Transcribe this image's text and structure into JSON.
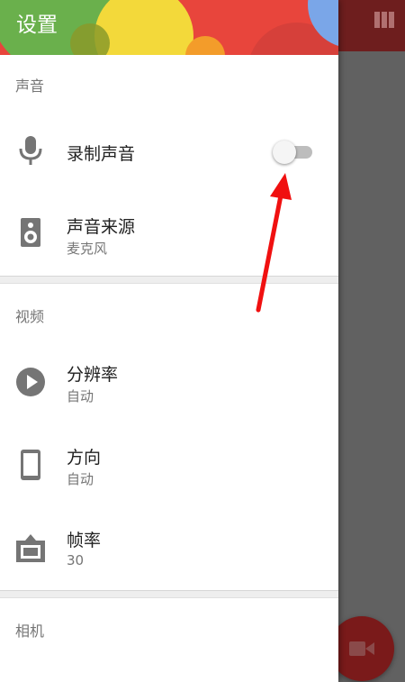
{
  "drawer": {
    "title": "设置"
  },
  "sections": {
    "audio": {
      "header": "声音",
      "record_audio": {
        "title": "录制声音",
        "icon": "microphone-icon",
        "enabled": false
      },
      "audio_source": {
        "title": "声音来源",
        "value": "麦克风",
        "icon": "speaker-icon"
      }
    },
    "video": {
      "header": "视频",
      "resolution": {
        "title": "分辨率",
        "value": "自动",
        "icon": "play-circle-icon"
      },
      "orientation": {
        "title": "方向",
        "value": "自动",
        "icon": "phone-icon"
      },
      "frame_rate": {
        "title": "帧率",
        "value": "30",
        "icon": "frame-icon"
      }
    },
    "camera": {
      "header": "相机"
    }
  },
  "background": {
    "appbar_icon": "view-column-icon",
    "fab_icon": "videocam-icon"
  },
  "colors": {
    "header_red": "#e8453c",
    "header_green": "#6ab04c",
    "header_yellow": "#f3d93a",
    "icon_gray": "#757575",
    "annotation_red": "#f01010"
  }
}
